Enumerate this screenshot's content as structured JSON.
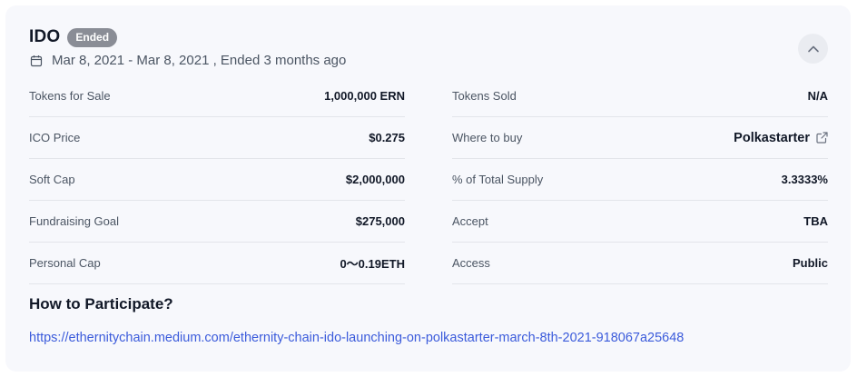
{
  "header": {
    "title": "IDO",
    "badge": "Ended",
    "date_text": "Mar 8, 2021 - Mar 8, 2021 , Ended 3 months ago"
  },
  "left_rows": [
    {
      "label": "Tokens for Sale",
      "value": "1,000,000 ERN"
    },
    {
      "label": "ICO Price",
      "value": "$0.275"
    },
    {
      "label": "Soft Cap",
      "value": "$2,000,000"
    },
    {
      "label": "Fundraising Goal",
      "value": "$275,000"
    },
    {
      "label": "Personal Cap",
      "value": "0～0.19ETH"
    }
  ],
  "right_rows": [
    {
      "label": "Tokens Sold",
      "value": "N/A"
    },
    {
      "label": "Where to buy",
      "value": "Polkastarter"
    },
    {
      "label": "% of Total Supply",
      "value": "3.3333%"
    },
    {
      "label": "Accept",
      "value": "TBA"
    },
    {
      "label": "Access",
      "value": "Public"
    }
  ],
  "participate": {
    "title": "How to Participate?",
    "link": "https://ethernitychain.medium.com/ethernity-chain-ido-launching-on-polkastarter-march-8th-2021-918067a25648"
  },
  "colors": {
    "card_background": "#f7f8fc",
    "badge": "#8a8d96",
    "link": "#3b5bdb"
  },
  "icons": {
    "date": "calendar-icon",
    "collapse": "chevron-up-icon",
    "external": "external-link-icon"
  }
}
